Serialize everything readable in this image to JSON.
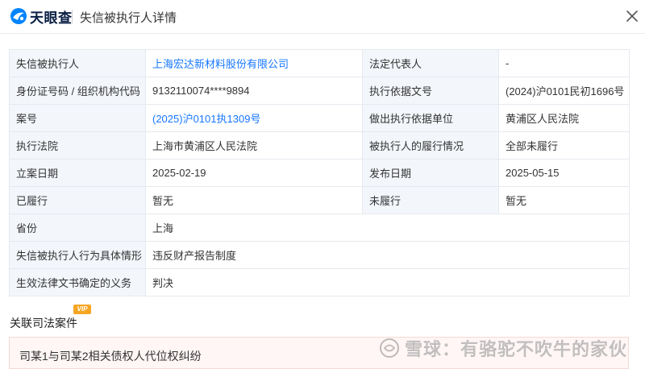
{
  "header": {
    "logo_text": "天眼查",
    "title": "失信被执行人详情"
  },
  "details": {
    "rows": [
      [
        {
          "label": "失信被执行人",
          "value": "上海宏达新材料股份有限公司"
        },
        {
          "label": "法定代表人",
          "value": "-"
        }
      ],
      [
        {
          "label": "身份证号码 / 组织机构代码",
          "value": "9132110074****9894"
        },
        {
          "label": "执行依据文号",
          "value": "(2024)沪0101民初1696号"
        }
      ],
      [
        {
          "label": "案号",
          "value": "(2025)沪0101执1309号"
        },
        {
          "label": "做出执行依据单位",
          "value": "黄浦区人民法院"
        }
      ],
      [
        {
          "label": "执行法院",
          "value": "上海市黄浦区人民法院"
        },
        {
          "label": "被执行人的履行情况",
          "value": "全部未履行"
        }
      ],
      [
        {
          "label": "立案日期",
          "value": "2025-02-19"
        },
        {
          "label": "发布日期",
          "value": "2025-05-15"
        }
      ],
      [
        {
          "label": "已履行",
          "value": "暂无"
        },
        {
          "label": "未履行",
          "value": "暂无"
        }
      ],
      [
        {
          "label": "省份",
          "value": "上海"
        }
      ],
      [
        {
          "label": "失信被执行人行为具体情形",
          "value": "违反财产报告制度"
        }
      ],
      [
        {
          "label": "生效法律文书确定的义务",
          "value": "判决"
        }
      ]
    ]
  },
  "related": {
    "section_title": "关联司法案件",
    "vip_label": "VIP",
    "case_title": "司某1与司某2相关债权人代位权纠纷"
  },
  "watermark": {
    "text": "雪球：有骆驼不吹牛的家伙"
  },
  "colors": {
    "link": "#1677ff",
    "label_bg": "#f3f6fb",
    "border": "#e6e9ef",
    "case_bg": "#fff6f5"
  }
}
